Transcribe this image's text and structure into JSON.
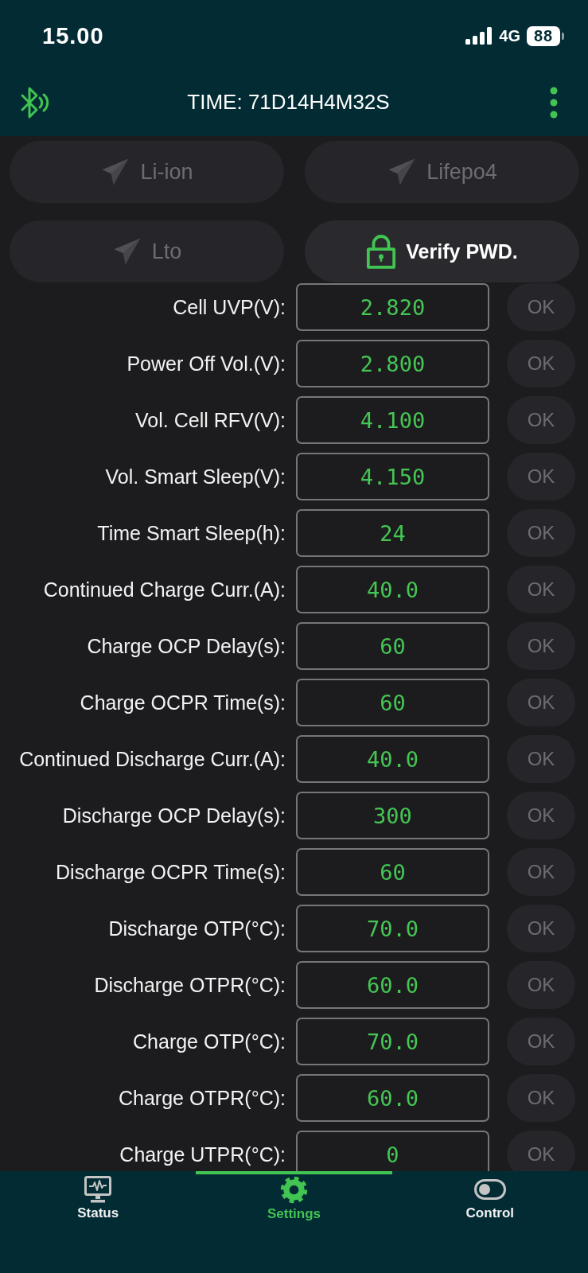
{
  "status_bar": {
    "time": "15.00",
    "network": "4G",
    "battery": "88"
  },
  "header": {
    "title": "TIME: 71D14H4M32S"
  },
  "presets": [
    {
      "kind": "preset",
      "label": "Li-ion",
      "disabled": true
    },
    {
      "kind": "preset",
      "label": "Lifepo4",
      "disabled": true
    },
    {
      "kind": "preset",
      "label": "Lto",
      "disabled": true
    },
    {
      "kind": "verify",
      "label": "Verify PWD.",
      "disabled": false
    }
  ],
  "parameters": [
    {
      "label": "Cell UVP(V):",
      "value": "2.820",
      "action": {
        "label": "OK",
        "disabled": true
      }
    },
    {
      "label": "Power Off Vol.(V):",
      "value": "2.800",
      "action": {
        "label": "OK",
        "disabled": true
      }
    },
    {
      "label": "Vol. Cell RFV(V):",
      "value": "4.100",
      "action": {
        "label": "OK",
        "disabled": true
      }
    },
    {
      "label": "Vol. Smart Sleep(V):",
      "value": "4.150",
      "action": {
        "label": "OK",
        "disabled": true
      }
    },
    {
      "label": "Time Smart Sleep(h):",
      "value": "24",
      "action": {
        "label": "OK",
        "disabled": true
      }
    },
    {
      "label": "Continued Charge Curr.(A):",
      "value": "40.0",
      "action": {
        "label": "OK",
        "disabled": true
      }
    },
    {
      "label": "Charge OCP Delay(s):",
      "value": "60",
      "action": {
        "label": "OK",
        "disabled": true
      }
    },
    {
      "label": "Charge OCPR Time(s):",
      "value": "60",
      "action": {
        "label": "OK",
        "disabled": true
      }
    },
    {
      "label": "Continued Discharge Curr.(A):",
      "value": "40.0",
      "action": {
        "label": "OK",
        "disabled": true
      }
    },
    {
      "label": "Discharge OCP Delay(s):",
      "value": "300",
      "action": {
        "label": "OK",
        "disabled": true
      }
    },
    {
      "label": "Discharge OCPR Time(s):",
      "value": "60",
      "action": {
        "label": "OK",
        "disabled": true
      }
    },
    {
      "label": "Discharge OTP(°C):",
      "value": "70.0",
      "action": {
        "label": "OK",
        "disabled": true
      }
    },
    {
      "label": "Discharge OTPR(°C):",
      "value": "60.0",
      "action": {
        "label": "OK",
        "disabled": true
      }
    },
    {
      "label": "Charge OTP(°C):",
      "value": "70.0",
      "action": {
        "label": "OK",
        "disabled": true
      }
    },
    {
      "label": "Charge OTPR(°C):",
      "value": "60.0",
      "action": {
        "label": "OK",
        "disabled": true
      }
    },
    {
      "label": "Charge UTPR(°C):",
      "value": "0",
      "action": {
        "label": "OK",
        "disabled": true
      }
    }
  ],
  "bottom_nav": [
    {
      "label": "Status",
      "selected": false
    },
    {
      "label": "Settings",
      "selected": true
    },
    {
      "label": "Control",
      "selected": false
    }
  ]
}
